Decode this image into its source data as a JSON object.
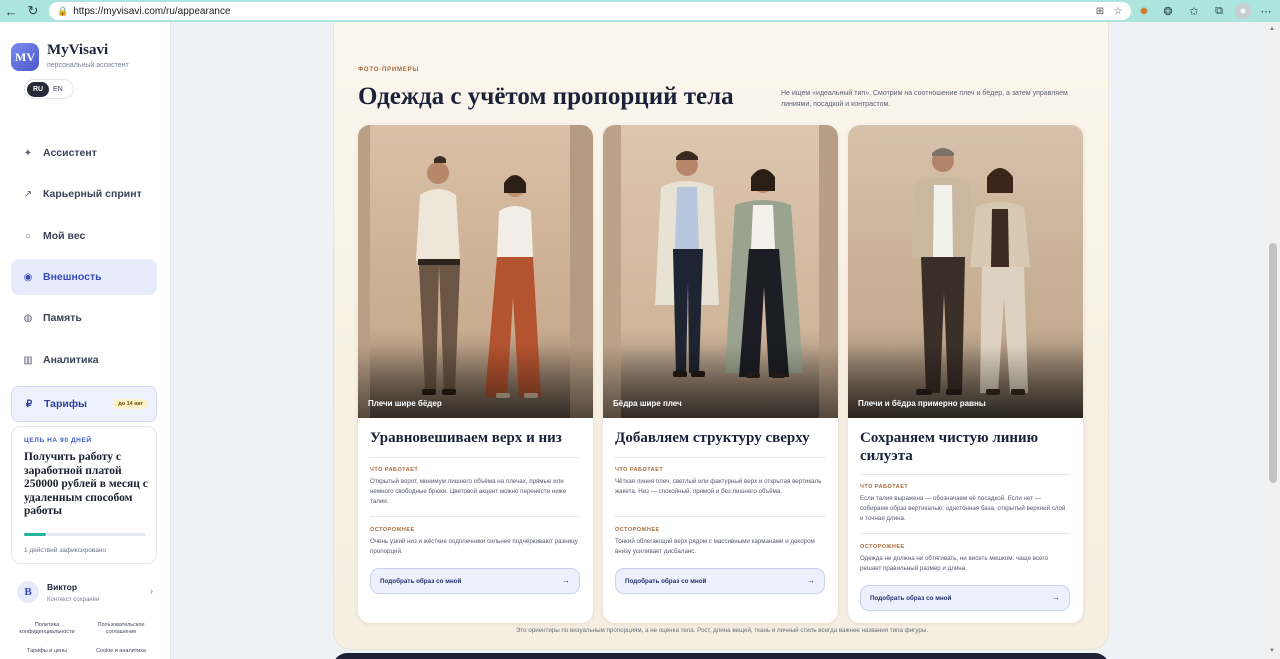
{
  "browser": {
    "url": "https://myvisavi.com/ru/appearance",
    "back_icon": "arrow-left-icon",
    "forward_icon": "arrow-right-icon",
    "reload_icon": "reload-icon"
  },
  "sidebar": {
    "logo_initials": "MV",
    "brand": "MyVisavi",
    "tagline": "персональный ассистент",
    "languages": [
      "RU",
      "EN"
    ],
    "active_language": "RU",
    "nav": [
      {
        "label": "Ассистент",
        "icon": "sparkle-icon"
      },
      {
        "label": "Карьерный спринт",
        "icon": "arrow-up-right-icon"
      },
      {
        "label": "Мой вес",
        "icon": "circle-icon"
      },
      {
        "label": "Внешность",
        "icon": "target-icon",
        "active": true
      },
      {
        "label": "Память",
        "icon": "memory-icon"
      },
      {
        "label": "Аналитика",
        "icon": "bar-chart-icon"
      }
    ],
    "tariff": {
      "label": "Тарифы",
      "icon": "ruble-icon",
      "badge": "до 14 авг"
    },
    "goal": {
      "kicker": "ЦЕЛЬ НА 90 ДНЕЙ",
      "title": "Получить работу с заработной платой 250000 рублей в месяц с удаленным способом работы",
      "progress": 0.18,
      "status": "1 действий зафиксировано"
    },
    "user": {
      "initial": "В",
      "name": "Виктор",
      "subtitle": "Контекст сохранён",
      "chevron": "›"
    },
    "footer_links": [
      "Политика конфиденциальности",
      "Пользовательское соглашение",
      "Тарифы и цены",
      "Cookie и аналитика"
    ]
  },
  "section": {
    "eyebrow": "ФОТО-ПРИМЕРЫ",
    "title": "Одежда с учётом пропорций тела",
    "lead": "Не ищем «идеальный тип». Смотрим на соотношение плеч и бёдер, а затем управляем линиями, посадкой и контрастом.",
    "note": "Это ориентиры по визуальным пропорциям, а не оценка тела. Рост, длина вещей, ткань и личный стиль всегда важнее названия типа фигуры."
  },
  "cards": [
    {
      "caption": "Плечи шире бёдер",
      "title": "Уравновешиваем верх и низ",
      "works_label": "ЧТО РАБОТАЕТ",
      "works_text": "Открытый ворот, минимум лишнего объёма на плечах, прямые или немного свободные брюки. Цветовой акцент можно перенести ниже талии.",
      "careful_label": "ОСТОРОЖНЕЕ",
      "careful_text": "Очень узкий низ и жёсткие подплечники сильнее подчёркивают разницу пропорций.",
      "button": "Подобрать образ со мной",
      "arrow": "→"
    },
    {
      "caption": "Бёдра шире плеч",
      "title": "Добавляем структуру сверху",
      "works_label": "ЧТО РАБОТАЕТ",
      "works_text": "Чёткая линия плеч, светлый или фактурный верх и открытая вертикаль жакета. Низ — спокойный, прямой и без лишнего объёма.",
      "careful_label": "ОСТОРОЖНЕЕ",
      "careful_text": "Тонкий облегающий верх рядом с массивными карманами и декором внизу усиливает дисбаланс.",
      "button": "Подобрать образ со мной",
      "arrow": "→"
    },
    {
      "caption": "Плечи и бёдра примерно равны",
      "title": "Сохраняем чистую линию силуэта",
      "works_label": "ЧТО РАБОТАЕТ",
      "works_text": "Если талия выражена — обозначаем её посадкой. Если нет — собираем образ вертикалью: однотонная база, открытый верхний слой и точная длина.",
      "careful_label": "ОСТОРОЖНЕЕ",
      "careful_text": "Одежда не должна ни обтягивать, ни висеть мешком: чаще всего решает правильный размер и длина.",
      "button": "Подобрать образ со мной",
      "arrow": "→"
    }
  ],
  "colors": {
    "accent": "#3749b8",
    "teal_progress": "#24b39c",
    "eyebrow": "#a86a3a",
    "browser_bar": "#abe5de"
  }
}
